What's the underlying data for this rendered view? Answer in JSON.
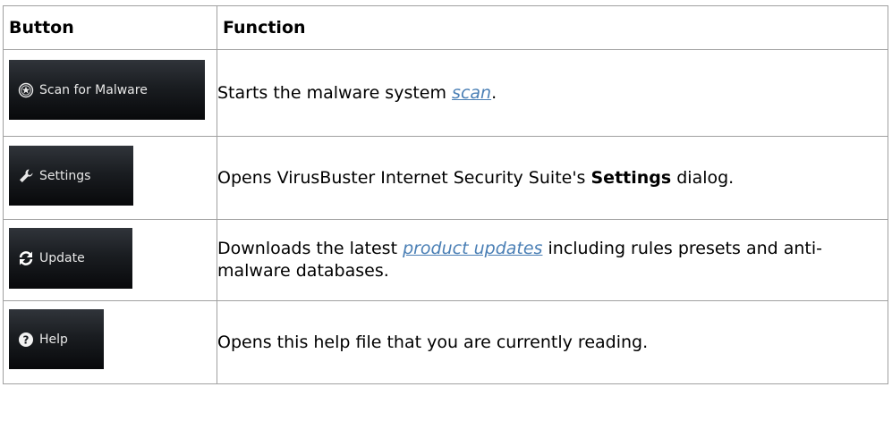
{
  "table": {
    "headers": {
      "button": "Button",
      "function": "Function"
    },
    "rows": [
      {
        "button_label": "Scan for Malware",
        "icon": "star-circle-icon",
        "desc_before": "Starts the malware system ",
        "link": "scan",
        "desc_after": "."
      },
      {
        "button_label": "Settings",
        "icon": "wrench-icon",
        "desc_before": "Opens VirusBuster Internet Security Suite's ",
        "bold": "Settings",
        "desc_after": " dialog."
      },
      {
        "button_label": "Update",
        "icon": "refresh-icon",
        "desc_before": "Downloads the latest ",
        "link": "product updates",
        "desc_after": " including rules presets and anti-malware databases."
      },
      {
        "button_label": "Help",
        "icon": "help-icon",
        "desc": "Opens this help file that you are currently reading."
      }
    ]
  },
  "colors": {
    "link": "#4a7fb5",
    "border": "#a0a0a0",
    "button_bg": "#1a1d21"
  }
}
